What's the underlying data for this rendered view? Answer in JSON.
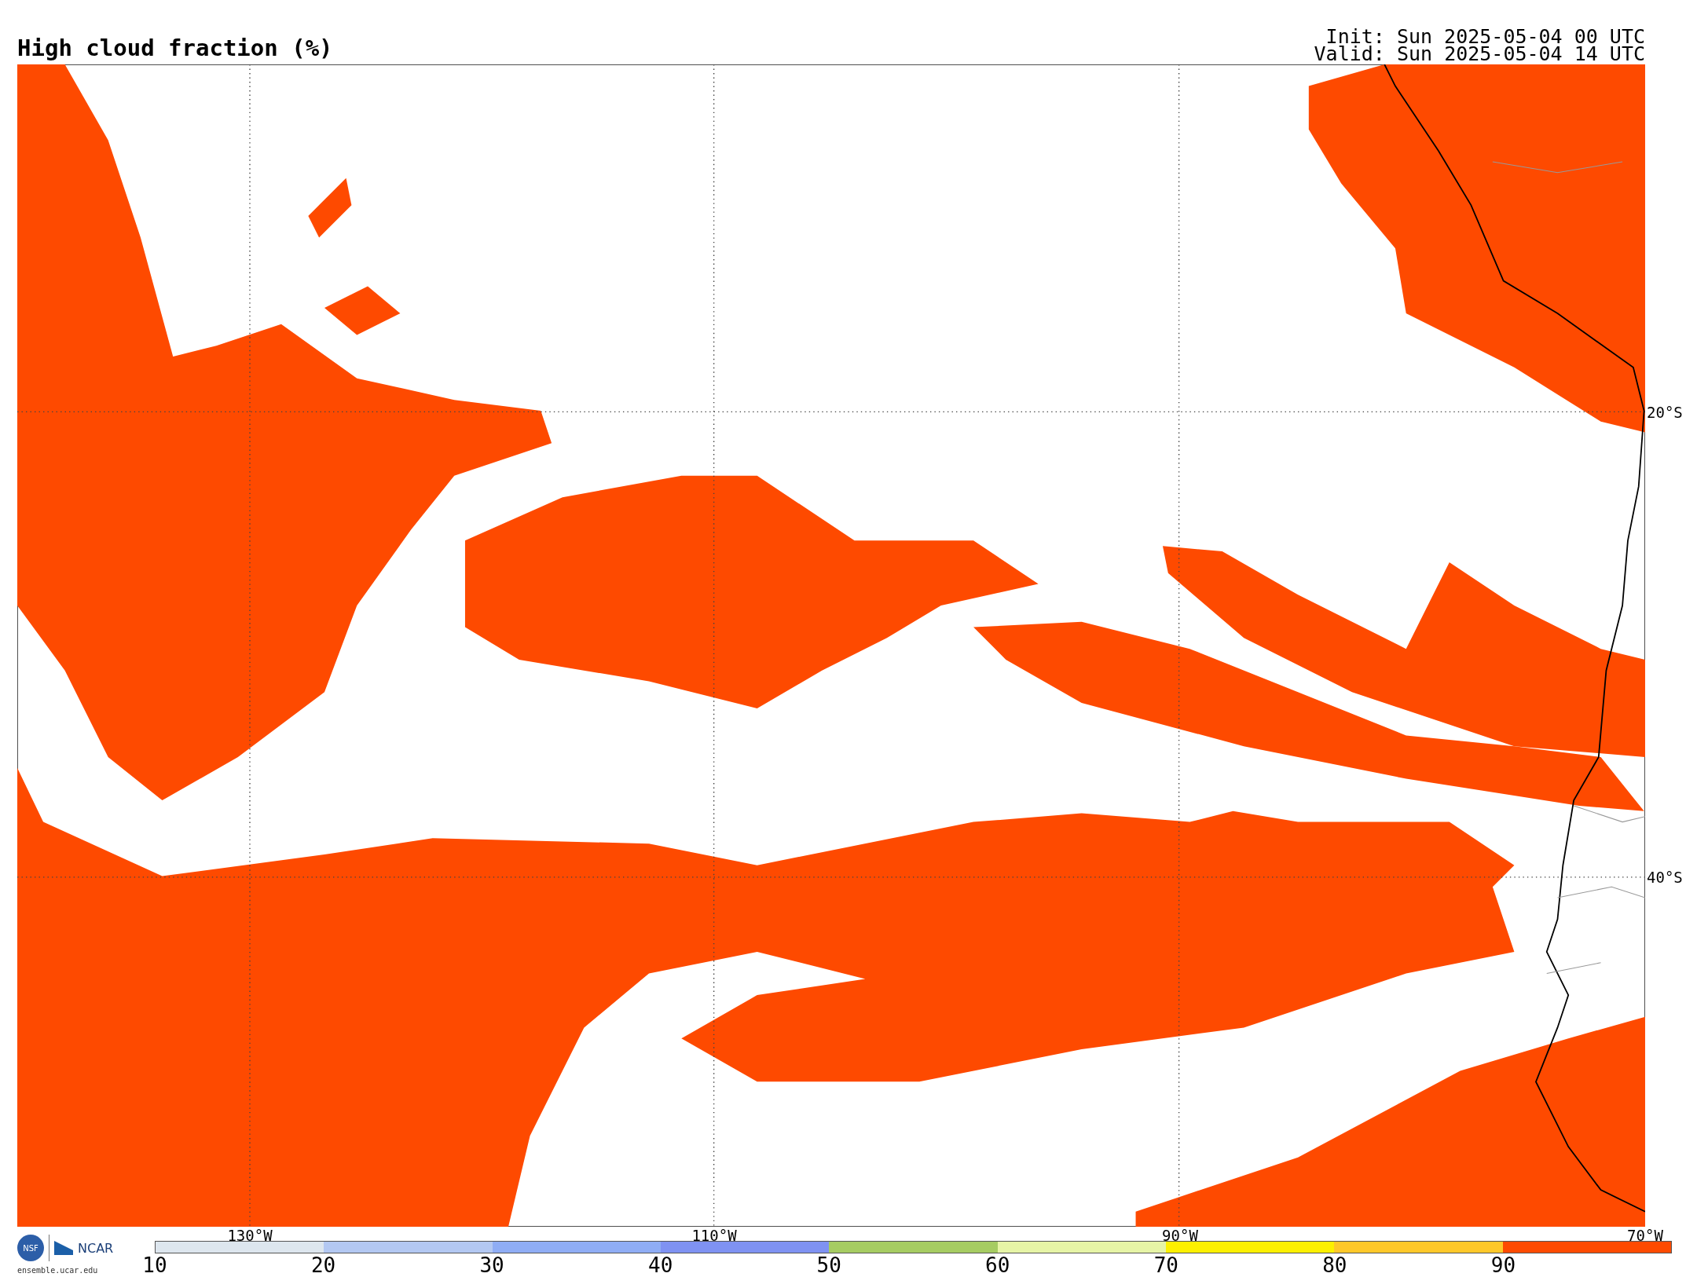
{
  "title": "High cloud fraction (%)",
  "run": {
    "init": "Init: Sun 2025-05-04 00 UTC",
    "valid": "Valid: Sun 2025-05-04 14 UTC"
  },
  "map": {
    "latitude_labels": [
      "20°S",
      "40°S"
    ],
    "longitude_labels": [
      "130°W",
      "110°W",
      "90°W",
      "70°W"
    ]
  },
  "logos": {
    "nsf": "NSF",
    "ncar": "NCAR",
    "url": "ensemble.ucar.edu"
  },
  "colorbar": {
    "bins": [
      {
        "color": "#dde6ee"
      },
      {
        "color": "#b3c8f2"
      },
      {
        "color": "#8fadf5"
      },
      {
        "color": "#7f92f2"
      },
      {
        "color": "#a6cc62"
      },
      {
        "color": "#e6f4a6"
      },
      {
        "color": "#fdf000"
      },
      {
        "color": "#fec82a"
      },
      {
        "color": "#fe4a00"
      }
    ],
    "ticks": [
      "10",
      "20",
      "30",
      "40",
      "50",
      "60",
      "70",
      "80",
      "90"
    ]
  }
}
